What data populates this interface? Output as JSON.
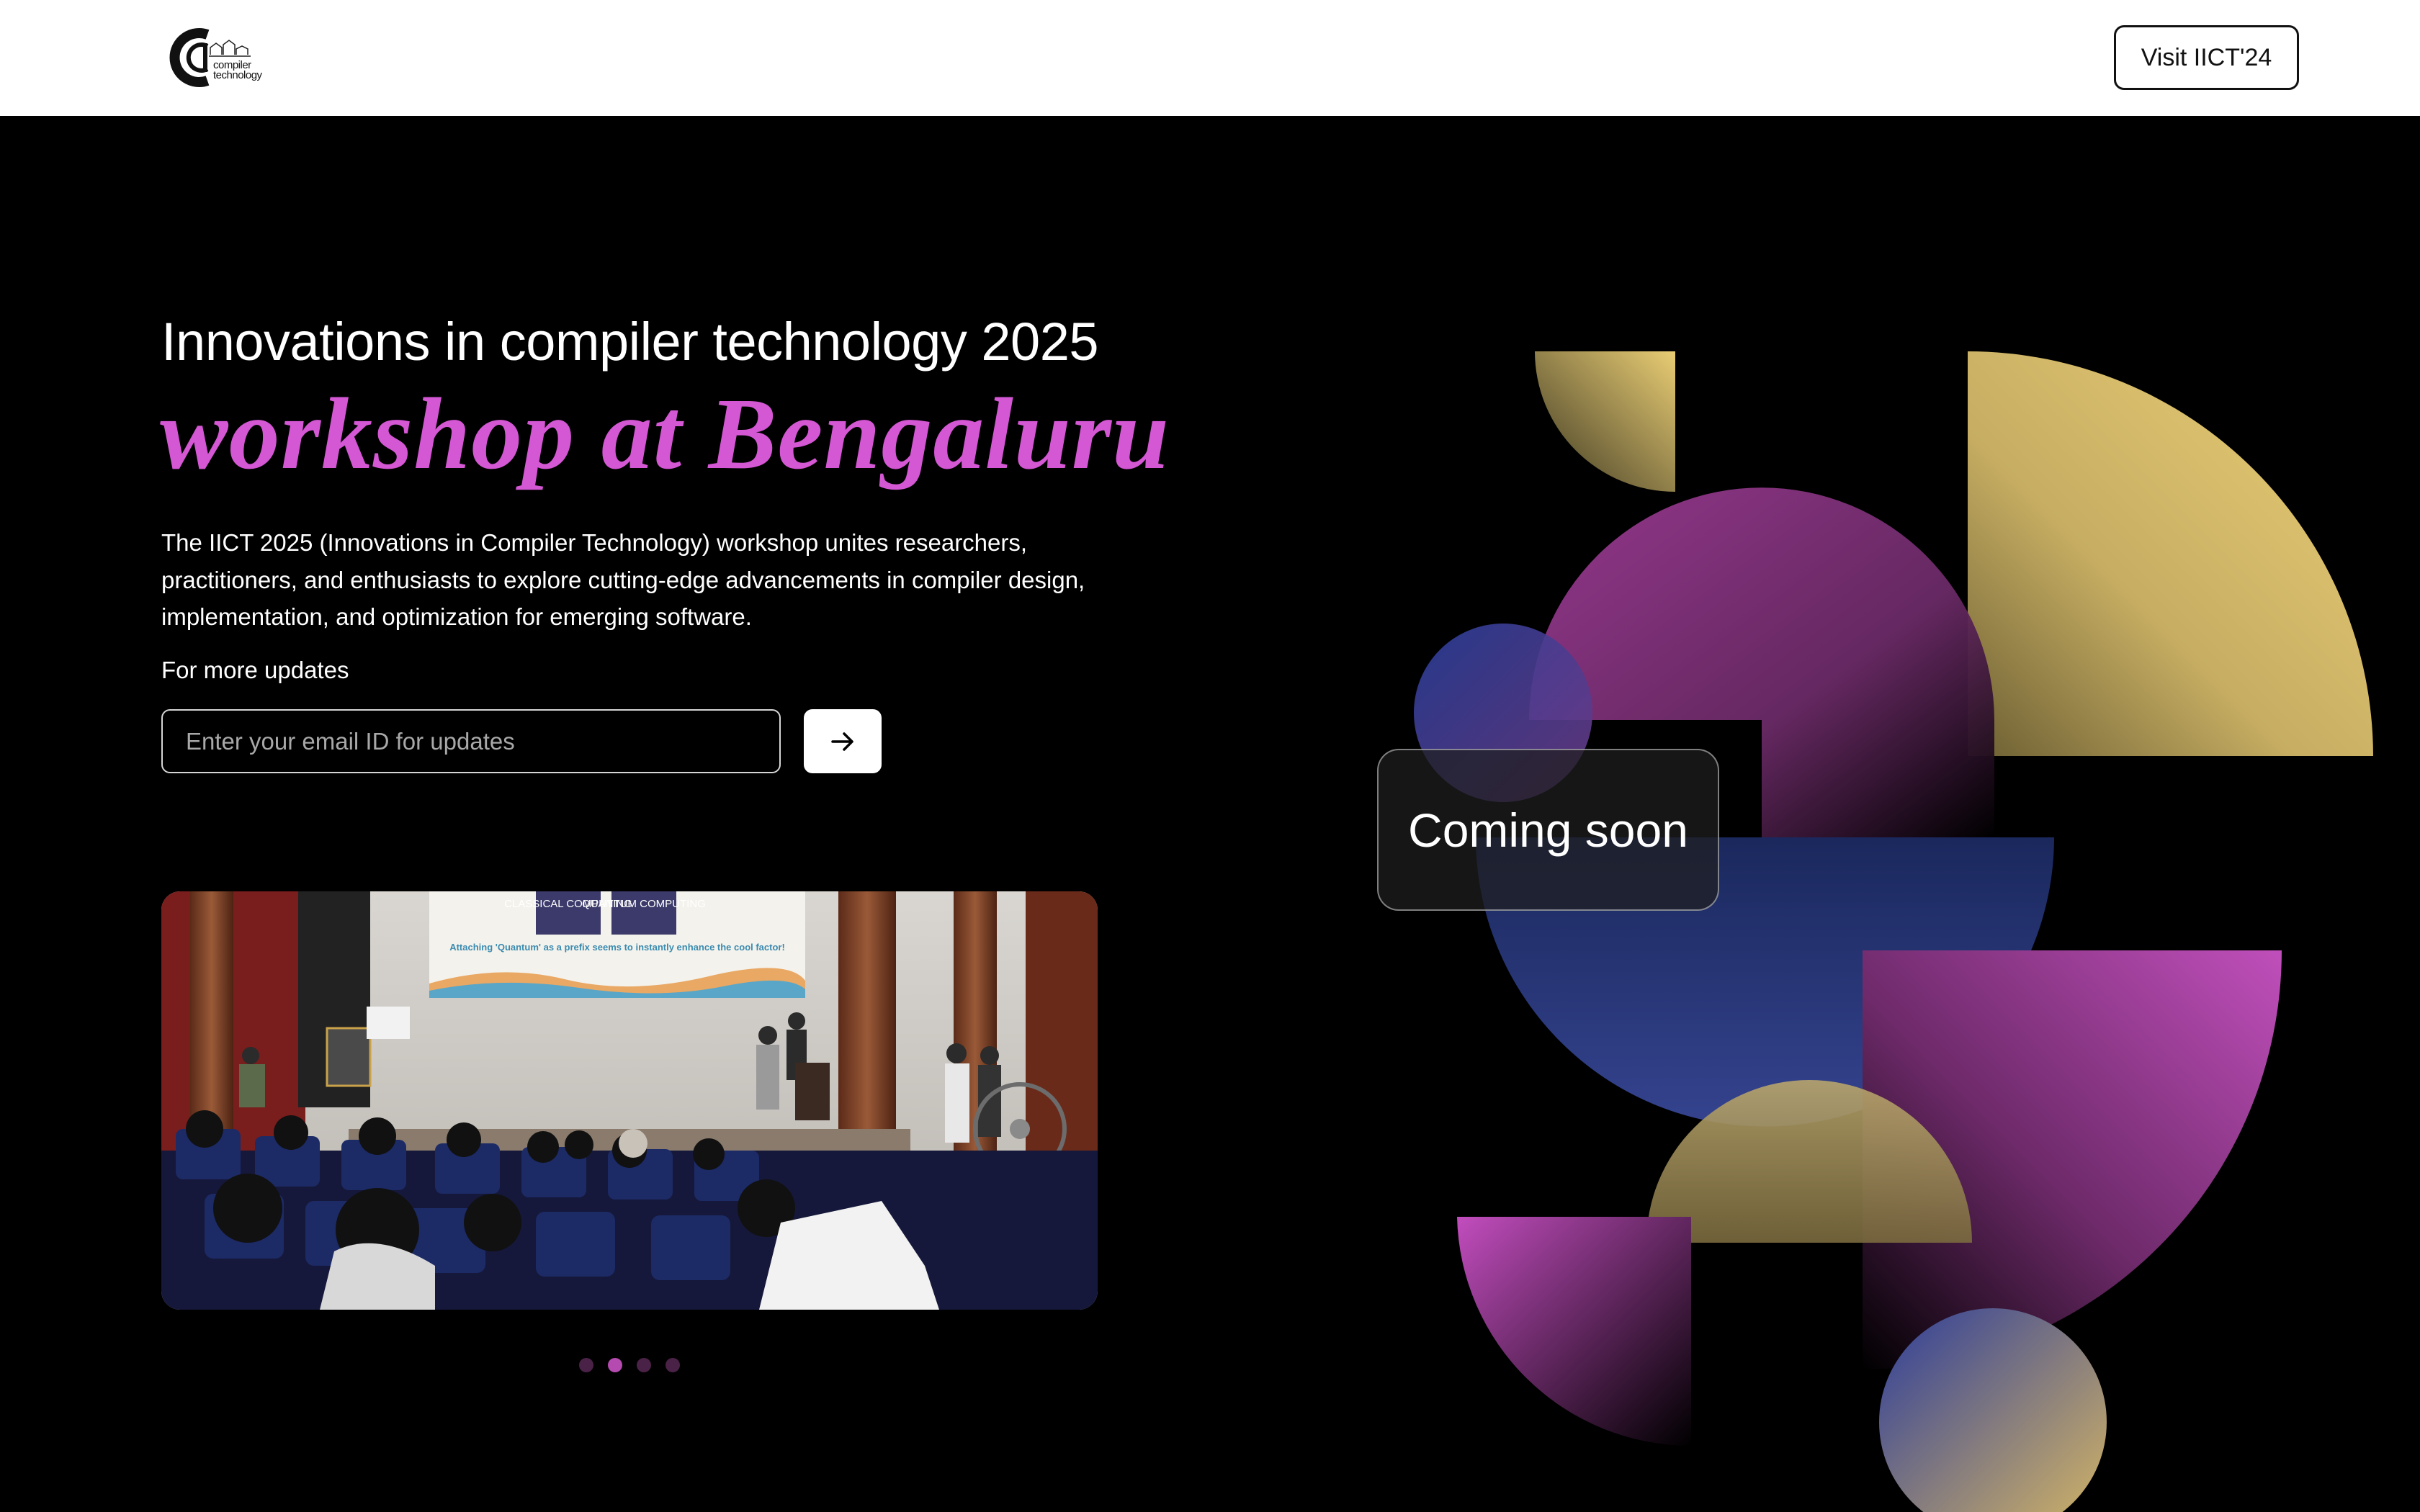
{
  "header": {
    "logo_text_line1": "compiler",
    "logo_text_line2": "technology",
    "visit_button": "Visit IICT'24"
  },
  "hero": {
    "title": "Innovations in compiler technology 2025",
    "subtitle": "workshop at Bengaluru",
    "description": "The IICT 2025 (Innovations in Compiler Technology) workshop unites researchers, practitioners, and enthusiasts to explore cutting-edge advancements in compiler design, implementation, and optimization for emerging software.",
    "updates_label": "For more updates",
    "email_placeholder": "Enter your email ID for updates"
  },
  "slide": {
    "slide_title_left": "CLASSICAL COMPUTING",
    "slide_title_right": "QUANTUM COMPUTING",
    "slide_caption": "Attaching 'Quantum' as a prefix seems to instantly enhance the cool factor!"
  },
  "carousel": {
    "slide_count": 4,
    "active_index": 1
  },
  "badge": {
    "coming_soon": "Coming soon"
  },
  "colors": {
    "accent_pink": "#d457d4",
    "gold": "#e6c86a",
    "magenta": "#b04aa8",
    "blue": "#2a3f9a"
  }
}
